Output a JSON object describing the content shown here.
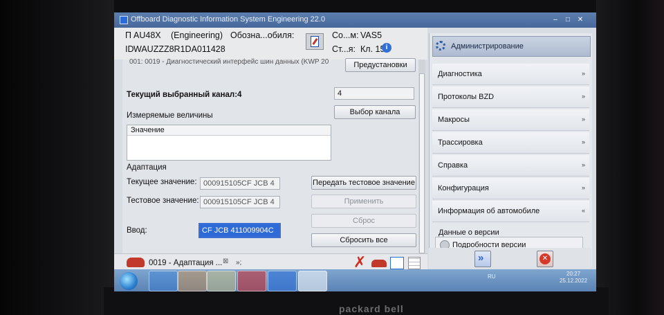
{
  "window": {
    "title": "Offboard Diagnostic Information System Engineering 22.0",
    "buttons": [
      "–",
      "□",
      "✕"
    ]
  },
  "header": {
    "vehicle_prefix": "П",
    "model": "AU48X",
    "mode": "(Engineering)",
    "designation_label": "Обозна...обиля:",
    "vin_prefix": "ID",
    "vin": "WAUZZZ8R1DA011428",
    "connection_label": "Со...м:",
    "connection_value": "VAS5",
    "status_label": "Ст...я:",
    "status_value": "Кл. 15"
  },
  "main": {
    "cutoff_line": "001: 0019 - Диагностический интерфейс шин данных (KWP 20",
    "presets_button": "Предустановки",
    "channel_label": "Текущий выбранный канал:",
    "channel_value": "4",
    "channel_input": "4",
    "select_channel_button": "Выбор канала",
    "measured_label": "Измеряемые величины",
    "measured_column": "Значение",
    "adaptation_label": "Адаптация",
    "current_label": "Текущее значение:",
    "current_value": "000915105CF JCB 4",
    "transfer_test_button": "Передать тестовое значение",
    "test_label": "Тестовое значение:",
    "test_value": "000915105CF JCB 4",
    "apply_button": "Применить",
    "input_label": "Ввод:",
    "input_value": "CF JCB 411009904C",
    "reset_button": "Сброс",
    "reset_all_button": "Сбросить все"
  },
  "bottom_tab": {
    "label": "0019 - Адаптация ...",
    "close": "⊠",
    "next": "»;"
  },
  "sidebar": {
    "header": "Администрирование",
    "items": [
      {
        "label": "Диагностика",
        "chevron": "»"
      },
      {
        "label": "Протоколы BZD",
        "chevron": "»"
      },
      {
        "label": "Макросы",
        "chevron": "»"
      },
      {
        "label": "Трассировка",
        "chevron": "»"
      },
      {
        "label": "Справка",
        "chevron": "»"
      },
      {
        "label": "Конфигурация",
        "chevron": "»"
      },
      {
        "label": "Информация об автомобиле",
        "chevron": "«"
      }
    ],
    "sub_section": "Данные о версии",
    "sub_item": "Подробности версии"
  },
  "taskbar": {
    "lang": "RU",
    "time": "20:27",
    "date": "25.12.2022"
  },
  "device": {
    "brand": "packard bell"
  },
  "colors": {
    "accent": "#2f6bd6",
    "titlebar": "#46679a",
    "next_button": "#2d63c8",
    "stop_button": "#d33a2c"
  }
}
